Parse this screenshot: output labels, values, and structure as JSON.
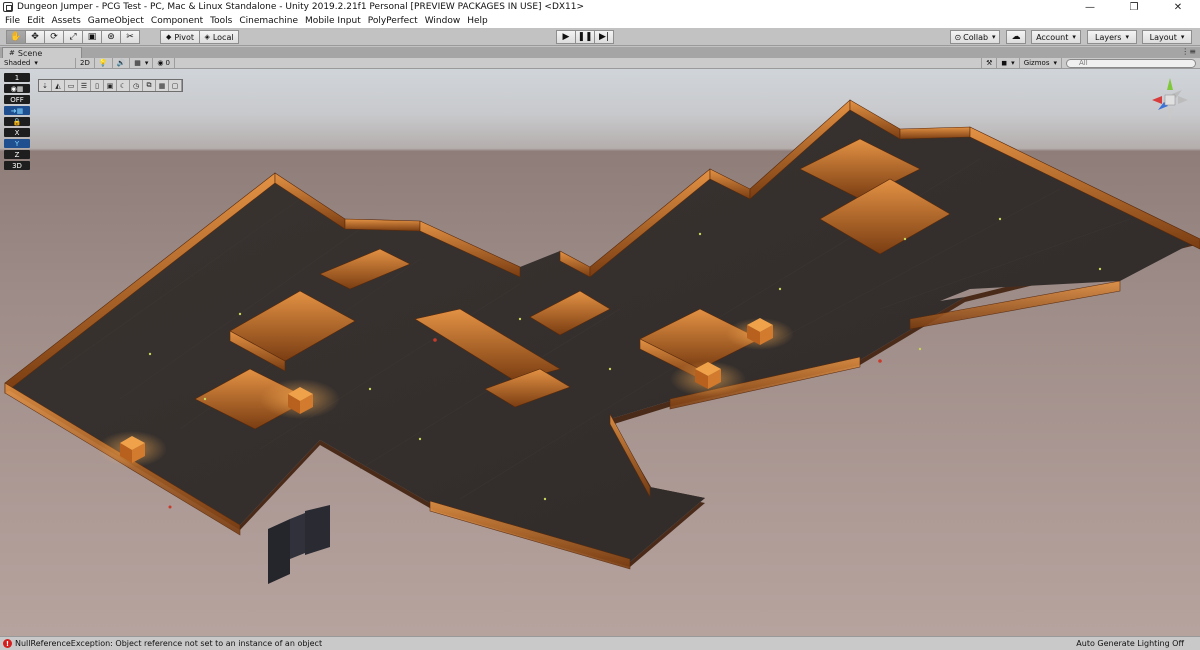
{
  "window": {
    "title": "Dungeon Jumper - PCG Test - PC, Mac & Linux Standalone - Unity 2019.2.21f1 Personal [PREVIEW PACKAGES IN USE] <DX11>",
    "controls": [
      "—",
      "❐",
      "✕"
    ]
  },
  "menu": [
    "File",
    "Edit",
    "Assets",
    "GameObject",
    "Component",
    "Tools",
    "Cinemachine",
    "Mobile Input",
    "PolyPerfect",
    "Window",
    "Help"
  ],
  "toolbar": {
    "transform_tools": [
      "hand-icon",
      "move-icon",
      "rotate-icon",
      "scale-icon",
      "rect-icon",
      "transform-icon",
      "custom-tool-icon"
    ],
    "pivot_label": "Pivot",
    "local_label": "Local",
    "collab_label": "Collab",
    "account_label": "Account",
    "layers_label": "Layers",
    "layout_label": "Layout"
  },
  "scene_tab": {
    "label": "Scene"
  },
  "scene_toolbar": {
    "shading_mode": "Shaded",
    "mode_2d": "2D",
    "fx_count": "0",
    "gizmos_label": "Gizmos",
    "search_placeholder": "All"
  },
  "overlay": {
    "layer_number": "1",
    "off_label": "OFF",
    "axis_x": "X",
    "axis_y": "Y",
    "axis_z": "Z",
    "mode_3d": "3D"
  },
  "gizmo": {
    "label": "",
    "colors": {
      "x": "#d83d3d",
      "y": "#7ec83a",
      "z": "#3d73d8"
    }
  },
  "status": {
    "error_message": "NullReferenceException: Object reference not set to an instance of an object",
    "right_label": "Auto Generate Lighting Off"
  },
  "colors": {
    "floor": "#3a3532",
    "wall_glow": "#d07a2a",
    "error": "#d51e1e"
  }
}
